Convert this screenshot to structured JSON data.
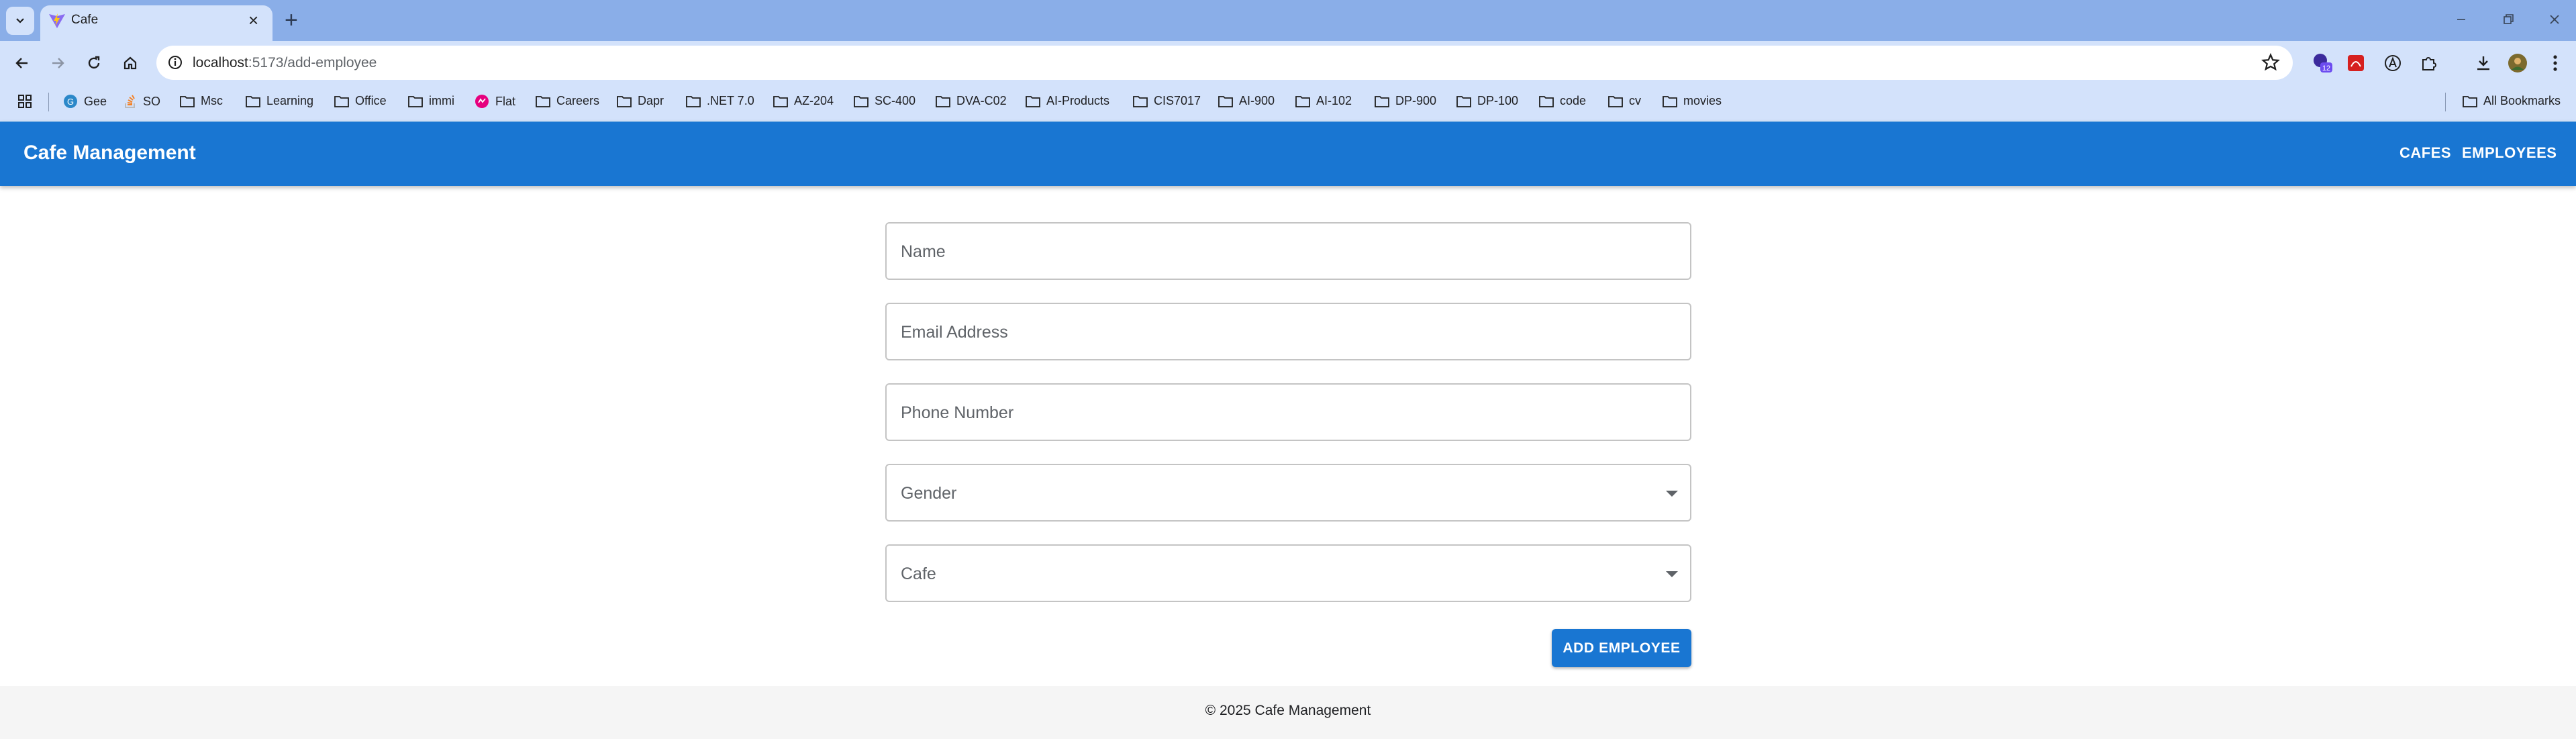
{
  "browser": {
    "tab_title": "Cafe",
    "address_host": "localhost",
    "address_path": ":5173/add-employee",
    "bookmarks": [
      "Gee",
      "SO",
      "Msc",
      "Learning",
      "Office",
      "immi",
      "Flat",
      "Careers",
      "Dapr",
      ".NET 7.0",
      "AZ-204",
      "SC-400",
      "DVA-C02",
      "AI-Products",
      "CIS7017",
      "AI-900",
      "AI-102",
      "DP-900",
      "DP-100",
      "code",
      "cv",
      "movies"
    ],
    "all_bookmarks": "All Bookmarks",
    "extension_badge": "12"
  },
  "app": {
    "title": "Cafe Management",
    "nav": [
      "CAFES",
      "EMPLOYEES"
    ]
  },
  "form": {
    "name_label": "Name",
    "email_label": "Email Address",
    "phone_label": "Phone Number",
    "gender_label": "Gender",
    "cafe_label": "Cafe",
    "submit_label": "ADD EMPLOYEE"
  },
  "footer": {
    "text": "© 2025 Cafe Management"
  },
  "colors": {
    "app_bar": "#1976d2",
    "browser_frame": "#8aaee8",
    "toolbar": "#d3e2fb"
  }
}
